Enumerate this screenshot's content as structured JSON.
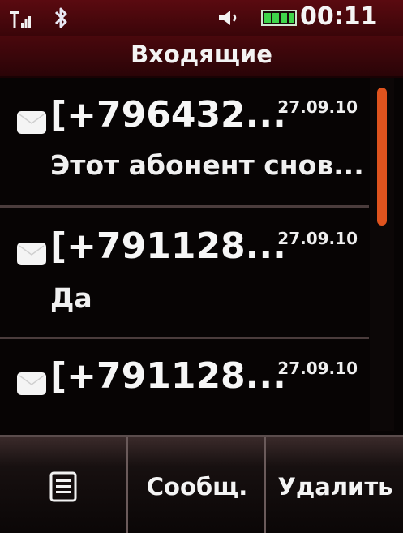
{
  "status_bar": {
    "icons": [
      "signal-icon",
      "bluetooth-icon",
      "volume-icon",
      "battery-icon"
    ],
    "time": "00:11"
  },
  "header": {
    "title": "Входящие"
  },
  "messages": [
    {
      "sender": "[+796432...",
      "date": "27.09.10",
      "preview": "Этот абонент снов...",
      "icon": "envelope-icon"
    },
    {
      "sender": "[+791128...",
      "date": "27.09.10",
      "preview": "Да",
      "icon": "envelope-icon"
    },
    {
      "sender": "[+791128...",
      "date": "27.09.10",
      "preview": "",
      "icon": "envelope-icon"
    }
  ],
  "softkeys": {
    "menu_icon": "menu-list-icon",
    "message_label": "Сообщ.",
    "delete_label": "Удалить"
  },
  "colors": {
    "accent": "#e0531e",
    "header_bg": "#4a080d",
    "battery": "#3fd64a"
  }
}
